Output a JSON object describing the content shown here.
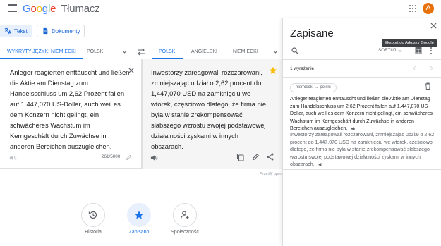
{
  "header": {
    "brand_letters": [
      "G",
      "o",
      "o",
      "g",
      "l",
      "e"
    ],
    "product": "Tłumacz",
    "avatar_letter": "A"
  },
  "modes": {
    "text_label": "Tekst",
    "documents_label": "Dokumenty"
  },
  "languages": {
    "detected": "WYKRYTY JĘZYK: NIEMIECKI",
    "source_alt": "POLSKI",
    "target_active": "POLSKI",
    "target_alt1": "ANGIELSKI",
    "target_alt2": "NIEMIECKI"
  },
  "source": {
    "text": "Anleger reagierten enttäuscht und ließen die Aktie am Dienstag zum Handelsschluss um 2,62 Prozent fallen auf 1.447,070 US-Dollar, auch weil es dem Konzern nicht gelingt, ein schwächeres Wachstum im Kerngeschäft durch Zuwächse in anderen Bereichen auszugleichen.",
    "char_count": "261/5000"
  },
  "target": {
    "text": "Inwestorzy zareagowali rozczarowani, zmniejszając udział o 2,62 procent do 1,447,070 USD na zamknięciu we wtorek, częściowo dlatego, że firma nie była w stanie zrekompensować słabszego wzrostu swojej podstawowej działalności zyskami w innych obszarach.",
    "feedback": "Prześlij opinię"
  },
  "bottom_nav": {
    "history": "Historia",
    "saved": "Zapisano",
    "community": "Społeczność"
  },
  "saved_panel": {
    "title": "Zapisane",
    "tooltip": "Eksport do Arkuszy Google",
    "sort_label": "SORTUJ",
    "count": "1 wyrażenie",
    "entry": {
      "pair": "niemiecki → polski",
      "source": "Anleger reagierten enttäuscht und ließen die Aktie am Dienstag zum Handelsschluss um 2,62 Prozent fallen auf 1.447,070 US-Dollar, auch weil es dem Konzern nicht gelingt, ein schwächeres Wachstum im Kerngeschäft durch Zuwächse in anderen Bereichen auszugleichen.",
      "target": "Inwestorzy zareagowali rozczarowani, zmniejszając udział o 2,62 procent do 1,447,070 USD na zamknięciu we wtorek, częściowo dlatego, że firma nie była w stanie zrekompensować słabszego wzrostu swojej podstawowej działalności zyskami w innych obszarach."
    }
  },
  "colors": {
    "accent": "#1a73e8",
    "star": "#fbbc05",
    "avatar": "#e8710a"
  }
}
